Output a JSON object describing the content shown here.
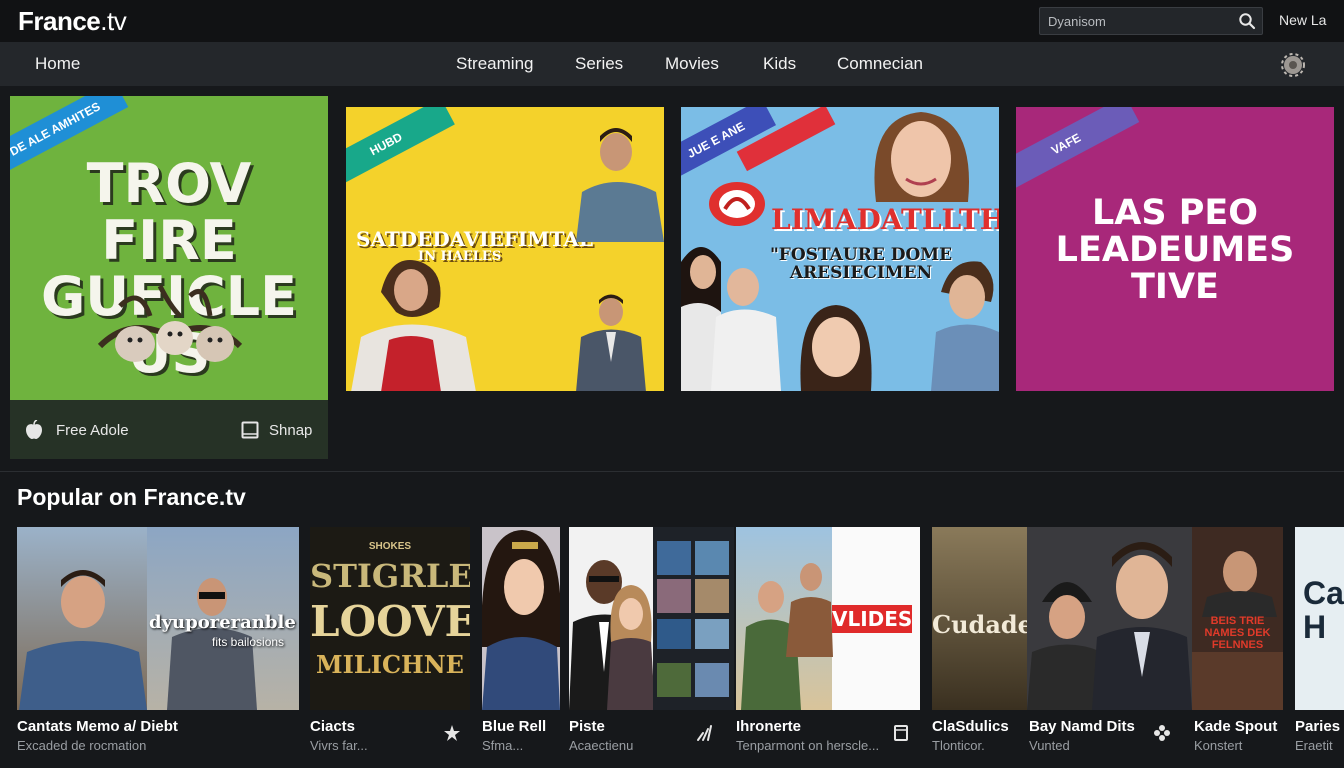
{
  "header": {
    "logo_main": "France",
    "logo_suffix": ".tv",
    "search_placeholder": "Dyanisom",
    "new_label": "New La"
  },
  "nav": {
    "home": "Home",
    "items": [
      "Streaming",
      "Series",
      "Movies",
      "Kids",
      "Comnecian"
    ]
  },
  "heroes": [
    {
      "ribbon": "DE ALE AMHITES",
      "title_line1": "TROV FIRE",
      "title_line2": "GUFICLE US",
      "footer_left": "Free Adole",
      "footer_right": "Shnap",
      "bg": "#6fb33e"
    },
    {
      "ribbon": "HUBD",
      "title_line1": "SATDEDAVIEFIMTAL",
      "title_line2": "IN HAELES",
      "bg": "#f4d22b"
    },
    {
      "ribbon": "JUE E ANE",
      "title_line1": "LIMADATLLTH",
      "title_line2": "\"FOSTAURE DOME",
      "title_line3": "ARESIECIMEN",
      "bg": "#7bbde6"
    },
    {
      "ribbon": "VAFE",
      "title_line1": "LAS PEO",
      "title_line2": "LEADEUMES",
      "title_line3": "TIVE",
      "bg": "#a8287a"
    }
  ],
  "popular": {
    "section_title": "Popular on France.tv",
    "cards": [
      {
        "title": "Cantats Memo a/ Diebt",
        "subtitle": "Excaded de rocmation",
        "poster_text": "dyuporeranble",
        "poster_sub": "fits bailosions"
      },
      {
        "title": "Ciacts",
        "subtitle": "Vivrs far...",
        "poster_text_top": "SHOKES",
        "poster_line1": "STIGRLE",
        "poster_line2": "LOOVE",
        "poster_line3": "MILICHNE"
      },
      {
        "title": "Blue Rell",
        "subtitle": "Sfma..."
      },
      {
        "title": "Piste",
        "subtitle": "Acaectienu"
      },
      {
        "title": "Ihronerte",
        "subtitle": "Tenparmont on herscle...",
        "poster_text": "VLIDES"
      },
      {
        "title": "ClaSdulics",
        "subtitle": "Tlonticor.",
        "poster_text": "Cudade"
      },
      {
        "title": "Bay Namd Dits",
        "subtitle": "Vunted"
      },
      {
        "title": "Kade Spout",
        "subtitle": "Konstert",
        "poster_text": "BEIS TRIE NAMES DEK FELNNES"
      },
      {
        "title": "Paries",
        "subtitle": "Eraetit",
        "poster_text": "Ca H"
      }
    ]
  },
  "colors": {
    "topbar": "#111214",
    "navbar": "#24272b",
    "background": "#16181b",
    "accent_red": "#e02a2a"
  }
}
